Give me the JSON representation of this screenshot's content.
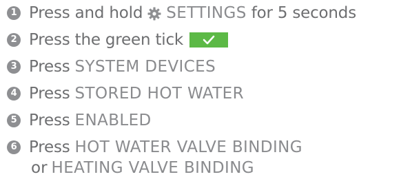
{
  "steps": [
    {
      "number": "1",
      "text": "Press and hold",
      "icon": "gear-icon",
      "keyword": "SETTINGS",
      "after": "for 5 seconds"
    },
    {
      "number": "2",
      "text": "Press the green tick",
      "icon": "green-tick-icon",
      "tick_color": "#5cb946"
    },
    {
      "number": "3",
      "text": "Press",
      "keyword": "SYSTEM DEVICES"
    },
    {
      "number": "4",
      "text": "Press",
      "keyword": "STORED HOT WATER"
    },
    {
      "number": "5",
      "text": "Press",
      "keyword": "ENABLED"
    },
    {
      "number": "6",
      "text": "Press",
      "keyword": "HOT WATER VALVE BINDING",
      "continuation_text": "or",
      "continuation_keyword": "HEATING VALVE BINDING"
    }
  ],
  "colors": {
    "text": "#6d6e70",
    "keyword": "#8a8b8e",
    "number_badge": "#8e8f92",
    "tick": "#5cb946"
  }
}
